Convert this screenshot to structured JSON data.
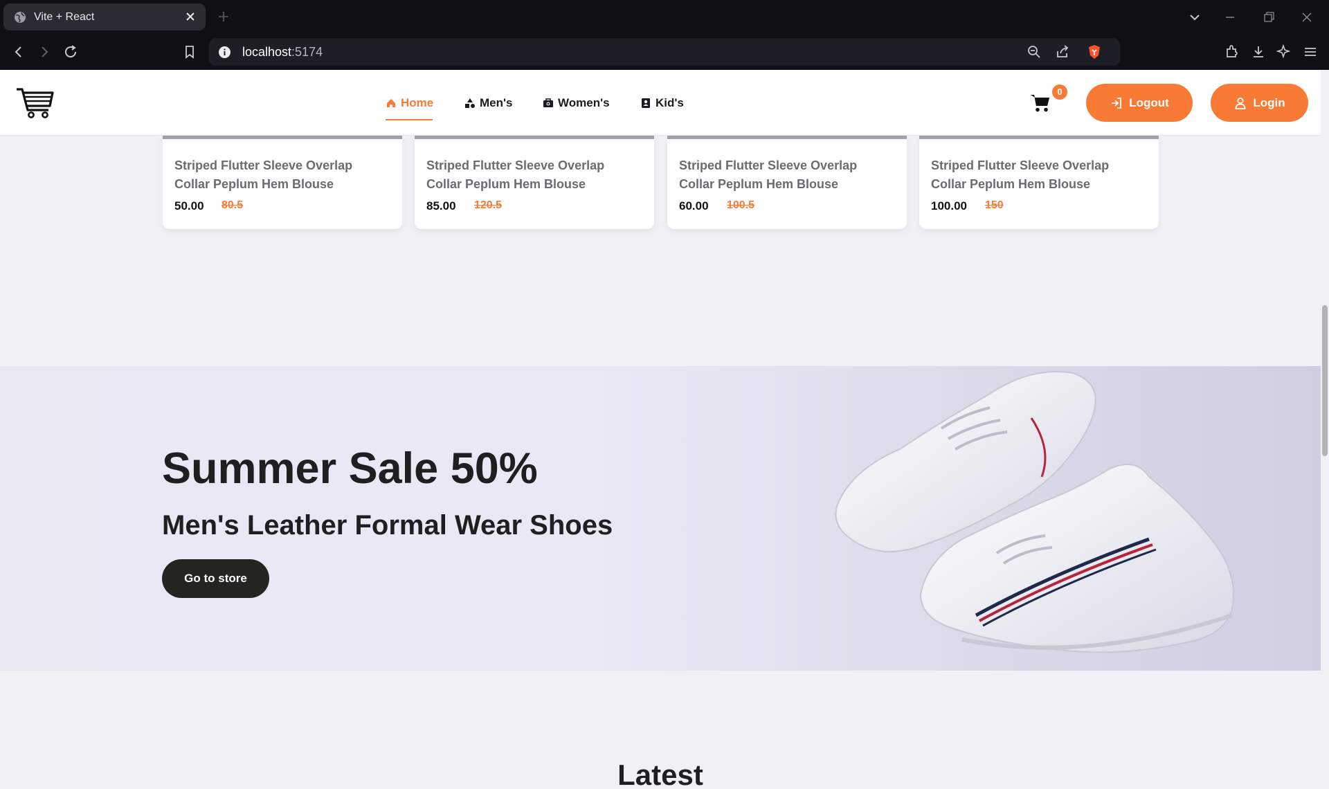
{
  "browser": {
    "tab_title": "Vite + React",
    "url_host": "localhost",
    "url_port": ":5174"
  },
  "nav": {
    "links": [
      {
        "label": "Home",
        "icon": "home-icon",
        "active": true
      },
      {
        "label": "Men's",
        "icon": "shapes-icon",
        "active": false
      },
      {
        "label": "Women's",
        "icon": "briefcase-icon",
        "active": false
      },
      {
        "label": "Kid's",
        "icon": "id-badge-icon",
        "active": false
      }
    ],
    "cart_count": "0",
    "logout_label": "Logout",
    "login_label": "Login"
  },
  "products": [
    {
      "name": "Striped Flutter Sleeve Overlap Collar Peplum Hem Blouse",
      "price": "50.00",
      "old_price": "80.5"
    },
    {
      "name": "Striped Flutter Sleeve Overlap Collar Peplum Hem Blouse",
      "price": "85.00",
      "old_price": "120.5"
    },
    {
      "name": "Striped Flutter Sleeve Overlap Collar Peplum Hem Blouse",
      "price": "60.00",
      "old_price": "100.5"
    },
    {
      "name": "Striped Flutter Sleeve Overlap Collar Peplum Hem Blouse",
      "price": "100.00",
      "old_price": "150"
    }
  ],
  "banner": {
    "title": "Summer Sale 50%",
    "subtitle": "Men's Leather Formal Wear Shoes",
    "button": "Go to store"
  },
  "section_heading": "Latest",
  "colors": {
    "accent": "#f97a34",
    "dark_button": "#24251f",
    "page_bg": "#f1f1f5"
  }
}
